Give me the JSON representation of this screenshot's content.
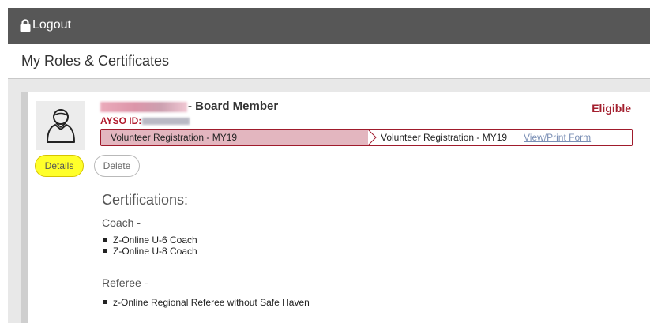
{
  "header": {
    "logout_label": "Logout",
    "icon": "lock-icon"
  },
  "page": {
    "title": "My Roles & Certificates"
  },
  "role_card": {
    "role_title": "- Board Member",
    "status": "Eligible",
    "ayso_id_label": "AYSO ID:",
    "avatar_icon": "user-avatar-icon",
    "progress": {
      "step1": "Volunteer Registration - MY19",
      "step2": "Volunteer Registration - MY19",
      "link": "View/Print Form"
    },
    "buttons": {
      "details": "Details",
      "delete": "Delete"
    }
  },
  "certifications": {
    "heading": "Certifications:",
    "coach": {
      "label": "Coach -",
      "items": [
        "Z-Online U-6 Coach",
        "Z-Online U-8 Coach"
      ]
    },
    "referee": {
      "label": "Referee -",
      "items": [
        "z-Online Regional Referee without Safe Haven"
      ]
    }
  },
  "colors": {
    "topbar": "#575757",
    "eligible": "#a31f2e",
    "progress_fill": "#e3b6bf",
    "progress_border": "#a01b2c",
    "details_highlight": "#ffff2a"
  }
}
